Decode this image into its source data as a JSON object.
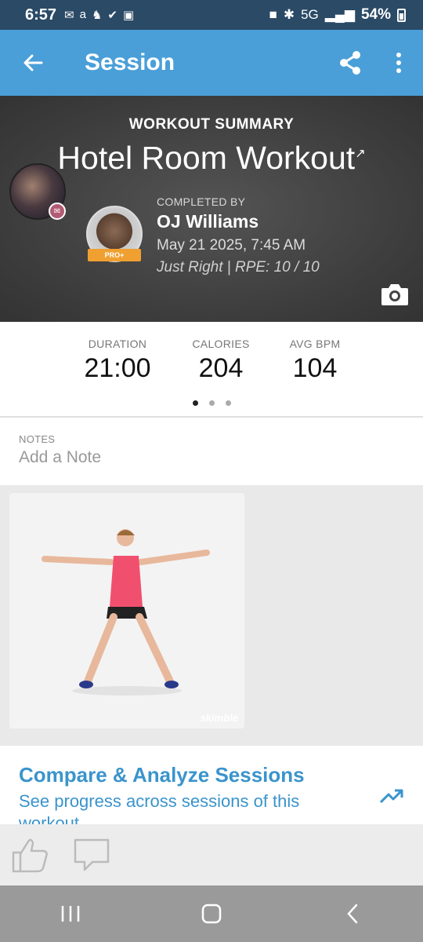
{
  "status_bar": {
    "time": "6:57",
    "icons": [
      "outlook-icon",
      "accessibility-text-icon",
      "steps-icon",
      "check-circle-icon",
      "image-icon"
    ],
    "network": "5G",
    "battery": "54%"
  },
  "app_bar": {
    "title": "Session"
  },
  "hero": {
    "label": "WORKOUT SUMMARY",
    "title": "Hotel Room Workout",
    "completed_by_label": "COMPLETED BY",
    "user_name": "OJ Williams",
    "pro_badge": "PRO+",
    "date": "May 21 2025, 7:45 AM",
    "rpe": "Just Right | RPE: 10 / 10"
  },
  "stats": [
    {
      "label": "DURATION",
      "value": "21:00"
    },
    {
      "label": "CALORIES",
      "value": "204"
    },
    {
      "label": "AVG BPM",
      "value": "104"
    }
  ],
  "pager": {
    "count": 3,
    "active_index": 0
  },
  "notes": {
    "label": "NOTES",
    "placeholder": "Add a Note"
  },
  "gallery": {
    "watermark": "skimble"
  },
  "compare": {
    "title": "Compare & Analyze Sessions",
    "subtitle": "See progress across sessions of this workout"
  },
  "colors": {
    "status_bar": "#2a4a66",
    "app_bar": "#4a9fd8",
    "accent": "#3a94cc",
    "hero_bg": "#3c3c3c",
    "pro_badge": "#f0a030",
    "top_shirt": "#f0506e"
  }
}
